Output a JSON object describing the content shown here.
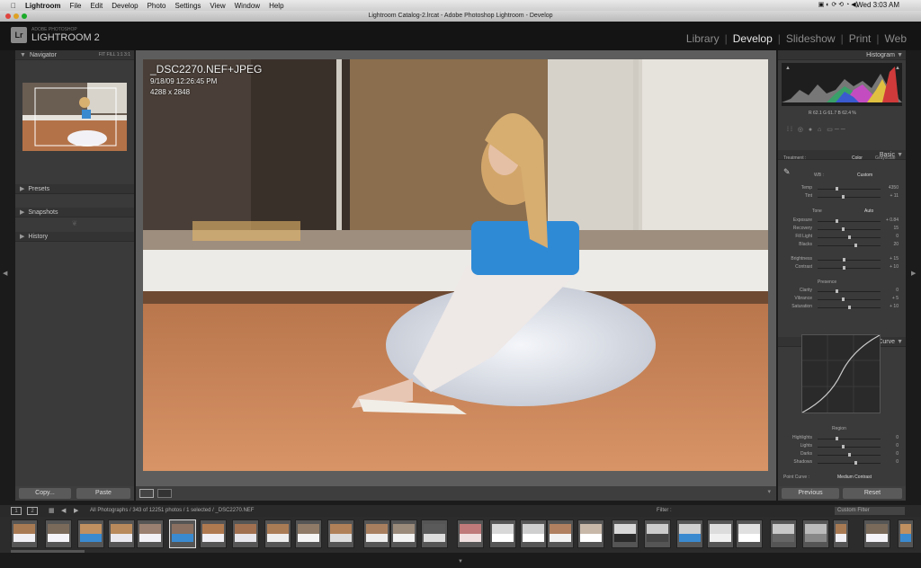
{
  "menubar": {
    "apple": "",
    "items": [
      "Lightroom",
      "File",
      "Edit",
      "Develop",
      "Photo",
      "Settings",
      "View",
      "Window",
      "Help"
    ],
    "clock": "Wed 3:03 AM"
  },
  "window": {
    "title": "Lightroom Catalog-2.lrcat - Adobe Photoshop Lightroom - Develop"
  },
  "brand": {
    "logo_letters": "Lr",
    "line1": "ADOBE PHOTOSHOP",
    "line2": "LIGHTROOM 2"
  },
  "modules": [
    "Library",
    "Develop",
    "Slideshow",
    "Print",
    "Web"
  ],
  "active_module": "Develop",
  "left_panel": {
    "navigator": "Navigator",
    "nav_zoom": "FIT  FILL  1:1  3:1",
    "sections": [
      "Presets",
      "Snapshots",
      "History"
    ],
    "copy_label": "Copy...",
    "paste_label": "Paste"
  },
  "photo_info": {
    "filename": "_DSC2270.NEF+JPEG",
    "datetime": "9/18/09 12:26:45 PM",
    "dimensions": "4288 x 2848"
  },
  "right_panel": {
    "histogram": "Histogram",
    "hist_readout": "R  62.1   G  61.7   B  62.4 %",
    "basic": "Basic",
    "treatment_label": "Treatment :",
    "treatment_color": "Color",
    "treatment_gray": "Grayscale",
    "wb_label": "WB :",
    "wb_value": "Custom",
    "tone_label": "Tone",
    "tone_auto": "Auto",
    "presence_label": "Presence",
    "tone_curve": "Tone Curve",
    "region_label": "Region",
    "point_curve_label": "Point Curve :",
    "point_curve_value": "Medium Contrast",
    "previous_label": "Previous",
    "reset_label": "Reset",
    "sliders_wb": [
      {
        "name": "Temp",
        "value": "4350"
      },
      {
        "name": "Tint",
        "value": "+ 11"
      }
    ],
    "sliders_tone": [
      {
        "name": "Exposure",
        "value": "+ 0.84"
      },
      {
        "name": "Recovery",
        "value": "15"
      },
      {
        "name": "Fill Light",
        "value": "0"
      },
      {
        "name": "Blacks",
        "value": "20"
      },
      {
        "name": "Brightness",
        "value": "+ 15"
      },
      {
        "name": "Contrast",
        "value": "+ 10"
      }
    ],
    "sliders_presence": [
      {
        "name": "Clarity",
        "value": "0"
      },
      {
        "name": "Vibrance",
        "value": "+ 5"
      },
      {
        "name": "Saturation",
        "value": "+ 10"
      }
    ],
    "sliders_region": [
      {
        "name": "Highlights",
        "value": "0"
      },
      {
        "name": "Lights",
        "value": "0"
      },
      {
        "name": "Darks",
        "value": "0"
      },
      {
        "name": "Shadows",
        "value": "0"
      }
    ]
  },
  "filmstrip": {
    "page1": "1",
    "page2": "2",
    "source": "All Photographs / 343 of 12251 photos / 1 selected / _DSC2270.NEF",
    "filter_label": "Filter :",
    "filter_value": "Custom Filter"
  }
}
